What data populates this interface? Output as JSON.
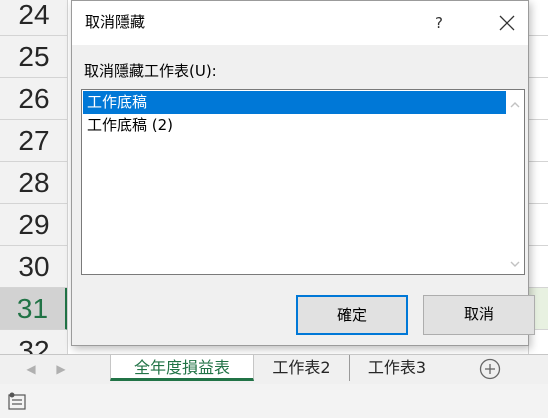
{
  "sheet": {
    "rows": [
      "24",
      "25",
      "26",
      "27",
      "28",
      "29",
      "30",
      "31",
      "32"
    ],
    "active_row": "31"
  },
  "dialog": {
    "title": "取消隱藏",
    "help_label": "?",
    "list_label": "取消隱藏工作表(U):",
    "list_items": [
      "工作底稿",
      "工作底稿 (2)"
    ],
    "selected_item": "工作底稿",
    "ok_label": "確定",
    "cancel_label": "取消"
  },
  "tabs": {
    "items": [
      "全年度損益表",
      "工作表2",
      "工作表3"
    ],
    "active": "全年度損益表"
  },
  "icons": {
    "close": "close-icon",
    "help": "help-icon",
    "scroll_up": "chevron-up-icon",
    "scroll_down": "chevron-down-icon",
    "tab_prev": "triangle-left-icon",
    "tab_next": "triangle-right-icon",
    "add_sheet": "plus-circle-icon",
    "status": "cell-mode-icon"
  },
  "colors": {
    "excel_green": "#217346",
    "selection_blue": "#0078d7"
  }
}
